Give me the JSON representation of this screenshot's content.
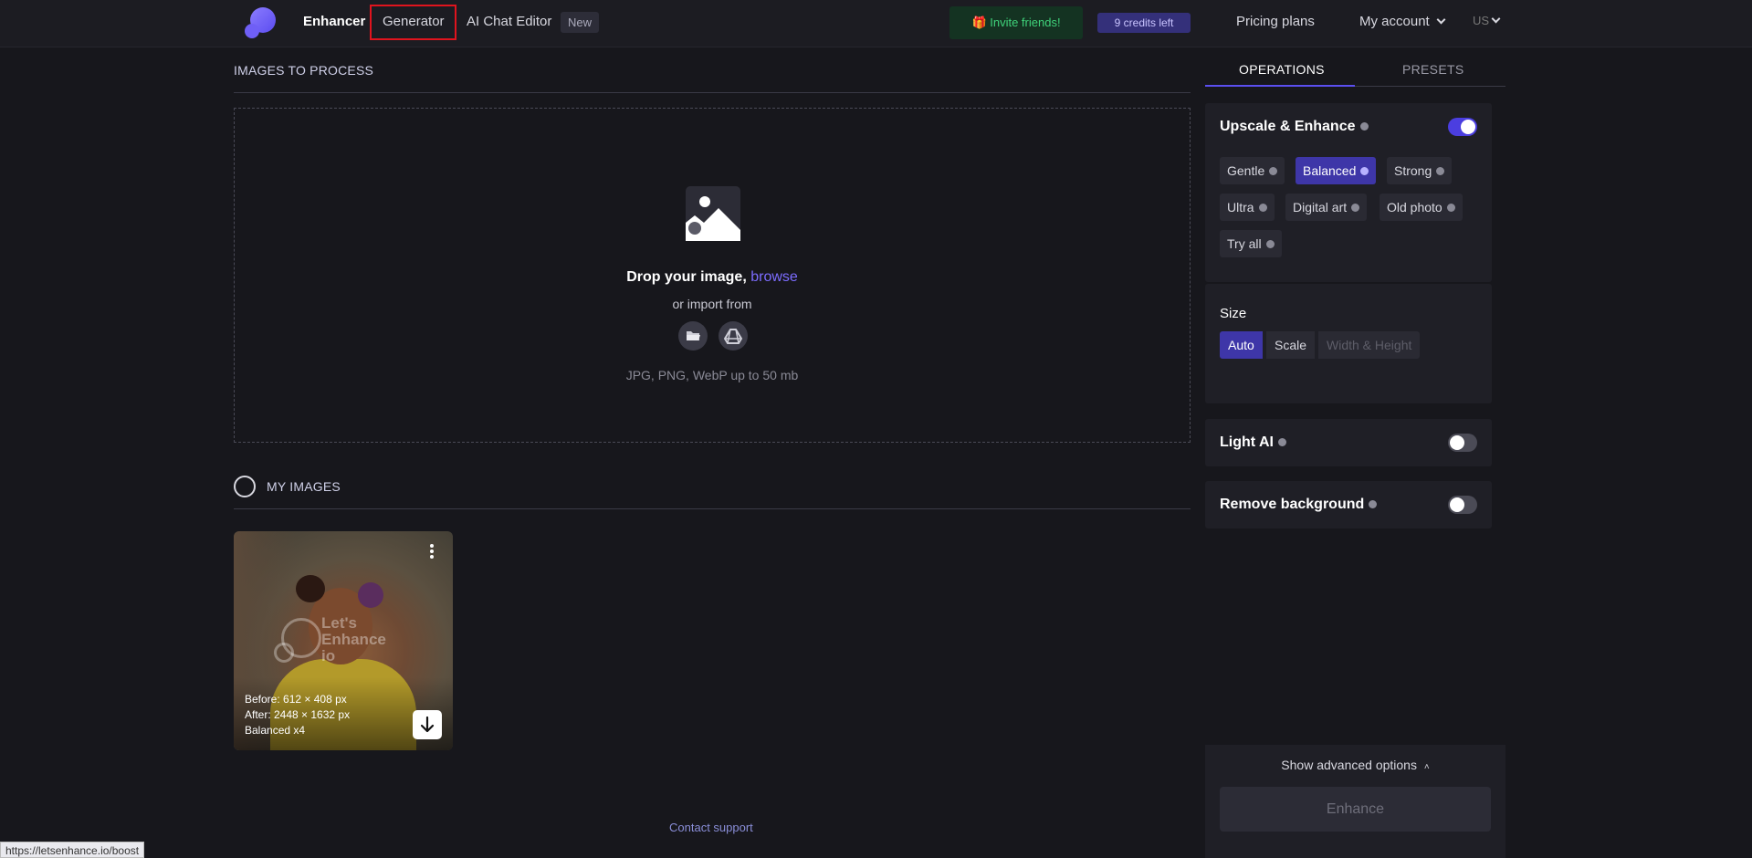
{
  "nav": {
    "enhancer": "Enhancer",
    "generator": "Generator",
    "ai_chat_editor": "AI Chat Editor",
    "new_badge": "New",
    "invite": "🎁 Invite friends!",
    "credits": "9 credits left",
    "pricing": "Pricing plans",
    "my_account": "My account",
    "lang": "US"
  },
  "left": {
    "images_to_process": "IMAGES TO PROCESS",
    "drop_text": "Drop your image,",
    "browse": "browse",
    "import_from": "or import from",
    "formats": "JPG, PNG, WebP up to 50 mb",
    "my_images": "MY IMAGES",
    "card": {
      "watermark": "Let's Enhance io",
      "before": "Before: 612 × 408 px",
      "after": "After: 2448 × 1632 px",
      "mode": "Balanced x4"
    },
    "contact_support": "Contact support"
  },
  "right": {
    "tabs": [
      "OPERATIONS",
      "PRESETS"
    ],
    "upscale": {
      "title": "Upscale & Enhance",
      "enabled": true,
      "modes": [
        "Gentle",
        "Balanced",
        "Strong",
        "Ultra",
        "Digital art",
        "Old photo",
        "Try all"
      ],
      "selected": "Balanced"
    },
    "size": {
      "title": "Size",
      "options": [
        "Auto",
        "Scale",
        "Width & Height"
      ],
      "selected": "Auto"
    },
    "light_ai": {
      "title": "Light AI",
      "enabled": false
    },
    "remove_bg": {
      "title": "Remove background",
      "enabled": false
    },
    "advanced": "Show advanced options",
    "enhance_button": "Enhance"
  },
  "status_url": "https://letsenhance.io/boost",
  "colors": {
    "accent": "#5b4ff0",
    "highlight_box": "#e0141e"
  }
}
